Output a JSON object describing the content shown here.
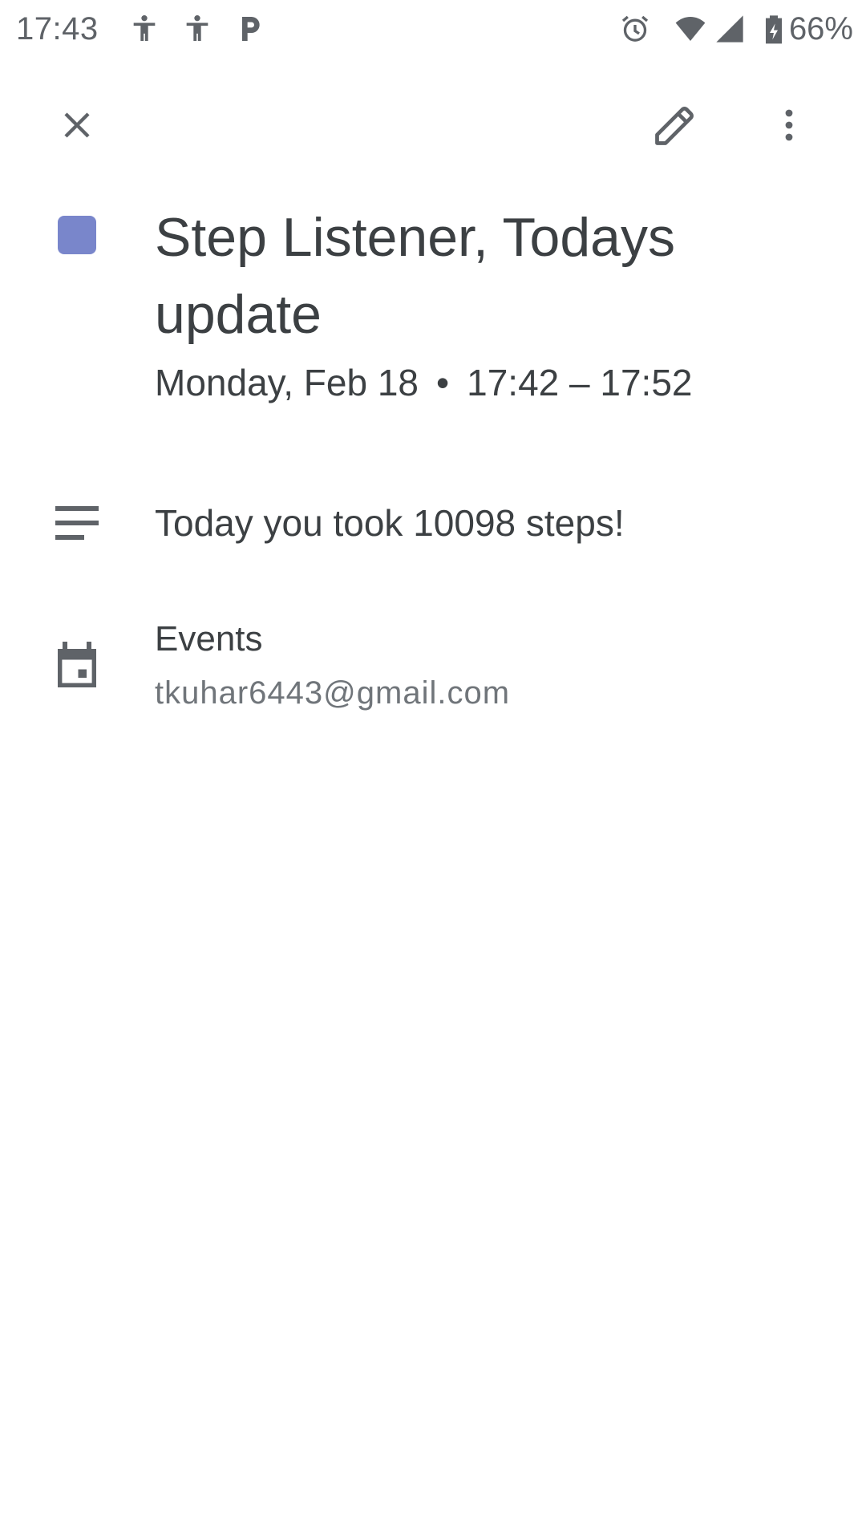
{
  "status_bar": {
    "time": "17:43",
    "battery": "66%",
    "icons": [
      "accessibility-icon",
      "accessibility-icon",
      "parking-app-icon",
      "alarm-icon",
      "wifi-icon",
      "cell-signal-icon",
      "battery-charging-icon"
    ]
  },
  "toolbar": {
    "close_icon": "close-icon",
    "edit_icon": "pencil-icon",
    "more_icon": "more-vert-icon"
  },
  "event": {
    "color": "#7986cb",
    "title": "Step Listener, Todays update",
    "date": "Monday, Feb 18",
    "separator": "•",
    "time_range": "17:42 – 17:52",
    "description": "Today you took 10098 steps!",
    "calendar_name": "Events",
    "calendar_account": "tkuhar6443@gmail.com"
  },
  "colors": {
    "text_primary": "#3c4043",
    "text_secondary": "#70757a",
    "icon": "#5f6368"
  }
}
